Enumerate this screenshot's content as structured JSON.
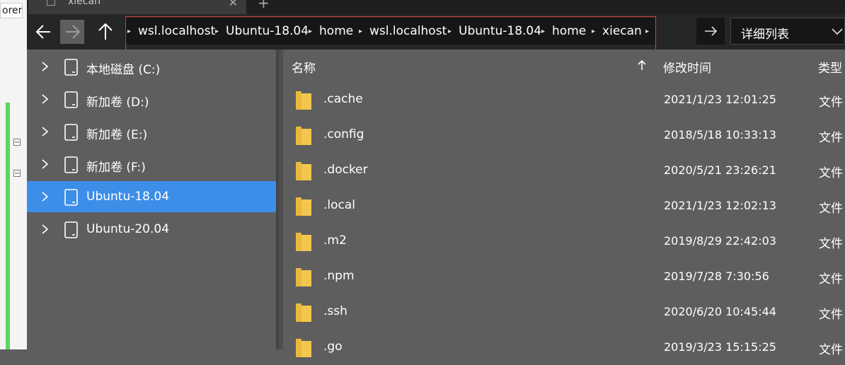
{
  "left_window": {
    "clipped_text": "orer"
  },
  "tab": {
    "title": "xiecan",
    "close_symbol": "✕",
    "new_tab_symbol": "+"
  },
  "breadcrumbs": [
    "wsl.localhost",
    "Ubuntu-18.04",
    "home",
    "wsl.localhost",
    "Ubuntu-18.04",
    "home",
    "xiecan"
  ],
  "view_select": {
    "value": "详细列表"
  },
  "sidebar": {
    "items": [
      {
        "label": "本地磁盘 (C:)",
        "selected": false
      },
      {
        "label": "新加卷 (D:)",
        "selected": false
      },
      {
        "label": "新加卷 (E:)",
        "selected": false
      },
      {
        "label": "新加卷 (F:)",
        "selected": false
      },
      {
        "label": "Ubuntu-18.04",
        "selected": true
      },
      {
        "label": "Ubuntu-20.04",
        "selected": false
      }
    ]
  },
  "columns": {
    "name": "名称",
    "modified": "修改时间",
    "type": "类型"
  },
  "files": [
    {
      "name": ".cache",
      "modified": "2021/1/23 12:01:25",
      "type": "文件"
    },
    {
      "name": ".config",
      "modified": "2018/5/18 10:33:13",
      "type": "文件"
    },
    {
      "name": ".docker",
      "modified": "2020/5/21 23:26:21",
      "type": "文件"
    },
    {
      "name": ".local",
      "modified": "2021/1/23 12:02:13",
      "type": "文件"
    },
    {
      "name": ".m2",
      "modified": "2019/8/29 22:42:03",
      "type": "文件"
    },
    {
      "name": ".npm",
      "modified": "2019/7/28 7:30:56",
      "type": "文件"
    },
    {
      "name": ".ssh",
      "modified": "2020/6/20 10:45:44",
      "type": "文件"
    },
    {
      "name": ".go",
      "modified": "2019/3/23 15:15:25",
      "type": "文件"
    }
  ],
  "colors": {
    "selected": "#3d8ee8",
    "folder": "#f3c74f",
    "highlight_box": "#d94040"
  }
}
